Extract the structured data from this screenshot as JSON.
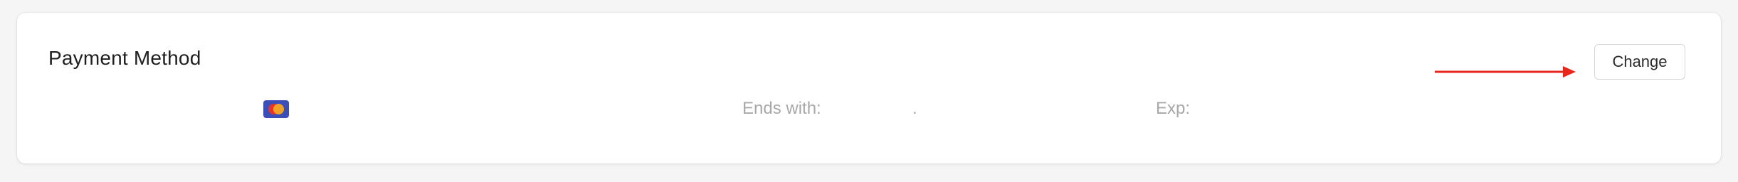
{
  "payment": {
    "title": "Payment Method",
    "ends_with_label": "Ends with:",
    "ends_with_value": "",
    "ends_with_separator": ".",
    "exp_label": "Exp:",
    "exp_value": "",
    "change_label": "Change"
  },
  "icons": {
    "card_brand": "mastercard-icon",
    "annotation": "arrow-right-icon"
  },
  "colors": {
    "arrow": "#e8261b",
    "card_bg": "#3c4fb8",
    "circle_left": "#e8332a",
    "circle_right": "#f7a823"
  }
}
